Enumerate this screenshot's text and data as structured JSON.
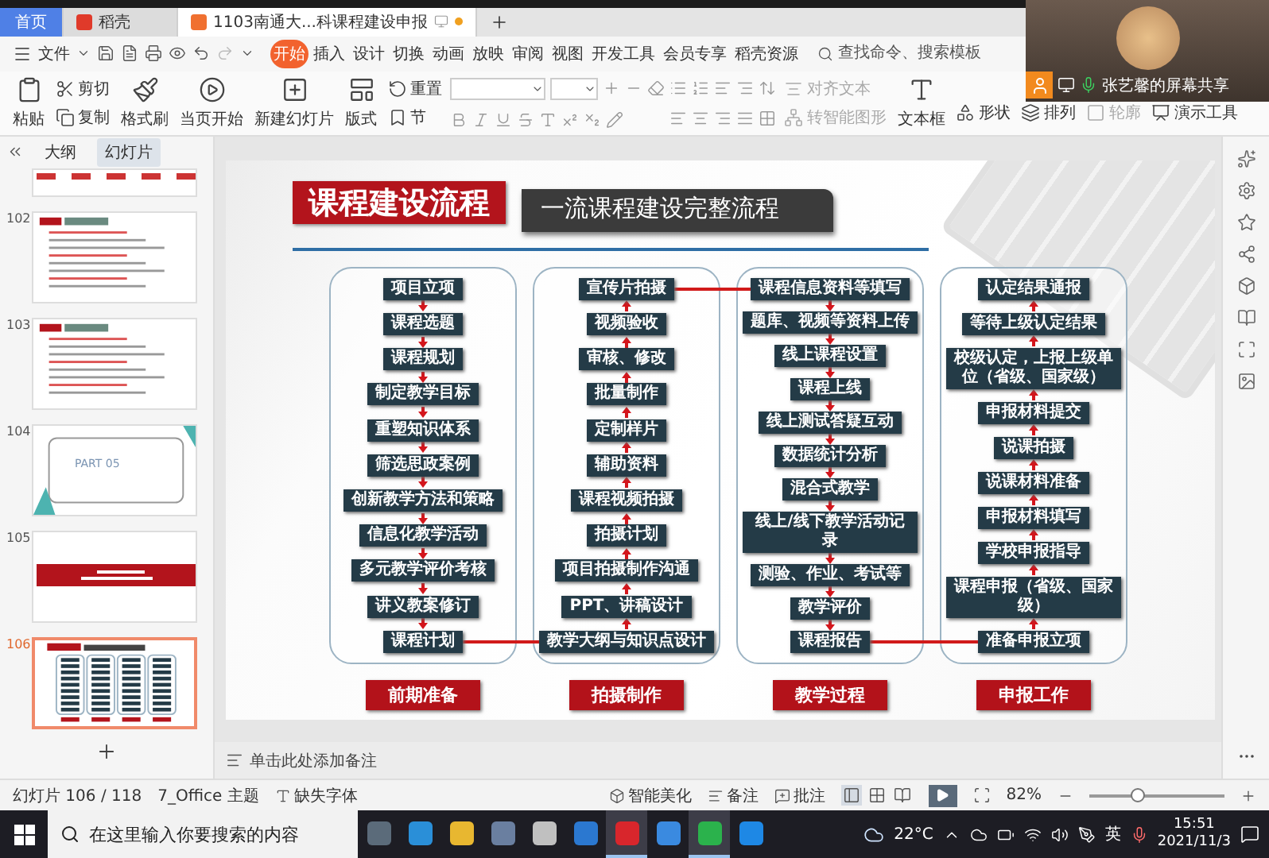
{
  "tabs": [
    {
      "label": "首页",
      "selected": false,
      "kind": "home"
    },
    {
      "label": "稻壳",
      "selected": false,
      "kind": "docer"
    },
    {
      "label": "1103南通大...科课程建设申报",
      "selected": true,
      "kind": "doc"
    }
  ],
  "menu": {
    "file": "文件",
    "tabs": [
      {
        "label": "开始",
        "selected": true
      },
      {
        "label": "插入",
        "selected": false
      },
      {
        "label": "设计",
        "selected": false
      },
      {
        "label": "切换",
        "selected": false
      },
      {
        "label": "动画",
        "selected": false
      },
      {
        "label": "放映",
        "selected": false
      },
      {
        "label": "审阅",
        "selected": false
      },
      {
        "label": "视图",
        "selected": false
      },
      {
        "label": "开发工具",
        "selected": false
      },
      {
        "label": "会员专享",
        "selected": false
      },
      {
        "label": "稻壳资源",
        "selected": false
      }
    ],
    "search": {
      "placeholder": "查找命令、搜索模板"
    }
  },
  "ribbon": [
    {
      "kind": "big",
      "label": "粘贴",
      "disabled": false
    },
    {
      "kind": "stack",
      "items": [
        {
          "label": "剪切",
          "disabled": false
        },
        {
          "label": "复制",
          "disabled": false
        }
      ]
    },
    {
      "kind": "big",
      "label": "格式刷",
      "disabled": false
    },
    {
      "kind": "big",
      "label": "当页开始",
      "disabled": false
    },
    {
      "kind": "big",
      "label": "新建幻灯片",
      "disabled": false
    },
    {
      "kind": "big",
      "label": "版式",
      "disabled": false
    },
    {
      "kind": "stack",
      "items": [
        {
          "label": "重置",
          "disabled": false
        },
        {
          "label": "节",
          "disabled": false
        }
      ]
    },
    {
      "kind": "font"
    },
    {
      "kind": "paragraph"
    },
    {
      "kind": "stack",
      "items": [
        {
          "label": "对齐文本",
          "disabled": true
        },
        {
          "label": "转智能图形",
          "disabled": true
        }
      ]
    },
    {
      "kind": "big",
      "label": "文本框",
      "disabled": false
    },
    {
      "kind": "inline",
      "label": "形状",
      "disabled": false
    },
    {
      "kind": "inline",
      "label": "排列",
      "disabled": false
    },
    {
      "kind": "inline",
      "label": "轮廓",
      "disabled": true
    },
    {
      "kind": "inline",
      "label": "演示工具",
      "disabled": false
    }
  ],
  "share": {
    "label": "张艺馨的屏幕共享"
  },
  "sidebar": {
    "tabs": [
      {
        "label": "大纲",
        "selected": false
      },
      {
        "label": "幻灯片",
        "selected": true
      }
    ],
    "slides": [
      {
        "kind": "cards",
        "selected": false
      },
      {
        "number": "102",
        "kind": "list",
        "selected": false
      },
      {
        "number": "103",
        "kind": "list",
        "selected": false
      },
      {
        "number": "104",
        "kind": "section",
        "title": "PART 05",
        "selected": false
      },
      {
        "number": "105",
        "kind": "banner",
        "selected": false
      },
      {
        "number": "106",
        "kind": "flow",
        "selected": true
      }
    ]
  },
  "slide": {
    "title": "课程建设流程",
    "subtitle": "一流课程建设完整流程",
    "columns": [
      {
        "label": "前期准备",
        "flow_up": false,
        "steps": [
          "项目立项",
          "课程选题",
          "课程规划",
          "制定教学目标",
          "重塑知识体系",
          "筛选思政案例",
          "创新教学方法和策略",
          "信息化教学活动",
          "多元教学评价考核",
          "讲义教案修订",
          "课程计划"
        ]
      },
      {
        "label": "拍摄制作",
        "flow_up": true,
        "steps": [
          "宣传片拍摄",
          "视频验收",
          "审核、修改",
          "批量制作",
          "定制样片",
          "辅助资料",
          "课程视频拍摄",
          "拍摄计划",
          "项目拍摄制作沟通",
          "PPT、讲稿设计",
          "教学大纲与知识点设计"
        ]
      },
      {
        "label": "教学过程",
        "flow_up": false,
        "steps": [
          "课程信息资料等填写",
          "题库、视频等资料上传",
          "线上课程设置",
          "课程上线",
          "线上测试答疑互动",
          "数据统计分析",
          "混合式教学",
          "线上/线下教学活动记录",
          "测验、作业、考试等",
          "教学评价",
          "课程报告"
        ]
      },
      {
        "label": "申报工作",
        "flow_up": true,
        "steps": [
          "认定结果通报",
          "等待上级认定结果",
          "校级认定，上报上级单位（省级、国家级）",
          "申报材料提交",
          "说课拍摄",
          "说课材料准备",
          "申报材料填写",
          "学校申报指导",
          "课程申报（省级、国家级）",
          "准备申报立项"
        ]
      }
    ]
  },
  "notes": {
    "placeholder": "单击此处添加备注"
  },
  "status": {
    "slide_count": "幻灯片 106 / 118",
    "theme": "7_Office 主题",
    "missing_fonts": "缺失字体",
    "beautify": "智能美化",
    "notes": "备注",
    "comments": "批注",
    "views": [
      {
        "selected": true
      },
      {
        "selected": false
      },
      {
        "selected": false
      }
    ],
    "zoom": "82%",
    "zoom_slider": {
      "level": 0.35
    }
  },
  "taskbar": {
    "search": {
      "placeholder": "在这里输入你要搜索的内容"
    },
    "apps": [
      {
        "active": false
      },
      {
        "active": false
      },
      {
        "active": false
      },
      {
        "active": false
      },
      {
        "active": false
      },
      {
        "active": false
      },
      {
        "active": true
      },
      {
        "active": false
      },
      {
        "active": true
      },
      {
        "active": false
      }
    ],
    "weather": "22°C",
    "language": "英",
    "time": "15:51",
    "date": "2021/11/3"
  }
}
